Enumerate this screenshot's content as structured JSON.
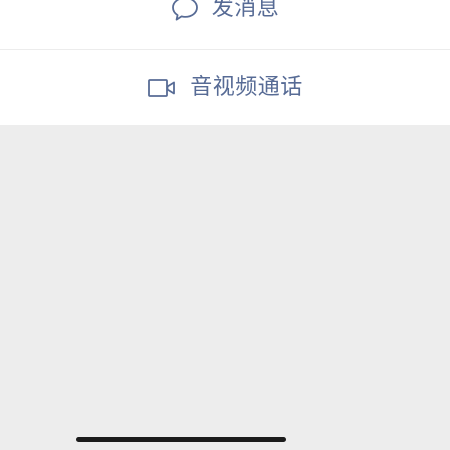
{
  "actions": [
    {
      "label": "发消息",
      "icon": "chat-bubble-icon"
    },
    {
      "label": "音视频通话",
      "icon": "video-camera-icon"
    }
  ],
  "colors": {
    "link": "#576b95",
    "background": "#ededed",
    "panel": "#ffffff",
    "home_indicator": "#1b1b1b"
  }
}
